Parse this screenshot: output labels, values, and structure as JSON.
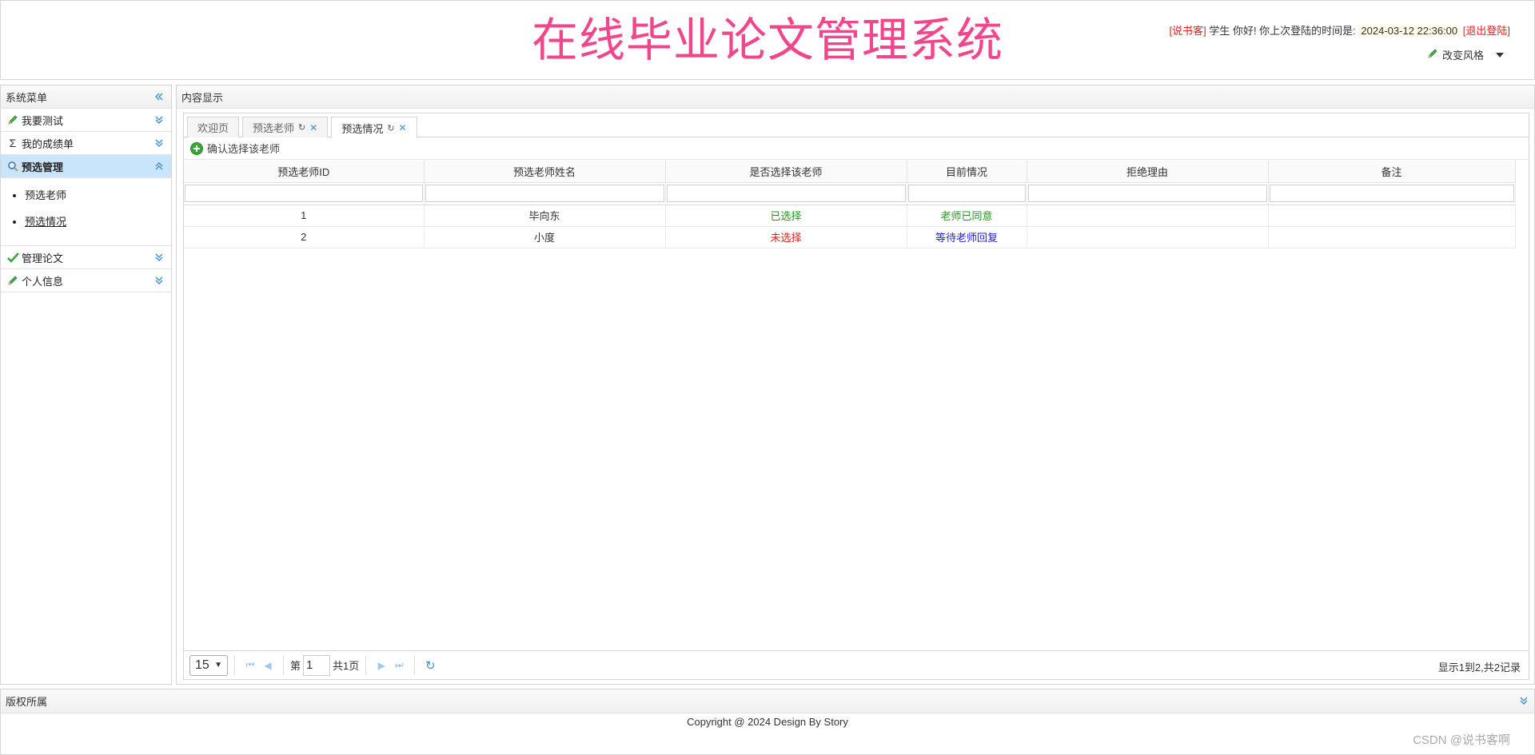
{
  "header": {
    "title": "在线毕业论文管理系统",
    "user_tag": "[说书客]",
    "greeting": "学生 你好! 你上次登陆的时间是:",
    "last_login": "2024-03-12 22:36:00",
    "logout": "[退出登陆]",
    "style_switch": "改变风格"
  },
  "sidebar": {
    "title": "系统菜单",
    "items": [
      {
        "label": "我要测试",
        "icon": "pencil-icon"
      },
      {
        "label": "我的成绩单",
        "icon": "sigma-icon"
      },
      {
        "label": "预选管理",
        "icon": "search-icon",
        "active": true
      },
      {
        "label": "管理论文",
        "icon": "check-icon"
      },
      {
        "label": "个人信息",
        "icon": "pencil-icon"
      }
    ],
    "sub_items": [
      "预选老师",
      "预选情况"
    ]
  },
  "center": {
    "title": "内容显示",
    "tabs": [
      {
        "label": "欢迎页"
      },
      {
        "label": "预选老师"
      },
      {
        "label": "预选情况"
      }
    ],
    "toolbar": {
      "confirm_label": "确认选择该老师"
    },
    "grid": {
      "columns": [
        "预选老师ID",
        "预选老师姓名",
        "是否选择该老师",
        "目前情况",
        "拒绝理由",
        "备注"
      ],
      "rows": [
        {
          "id": "1",
          "name": "毕向东",
          "selected": "已选择",
          "status": "老师已同意",
          "reason": "",
          "note": ""
        },
        {
          "id": "2",
          "name": "小度",
          "selected": "未选择",
          "status": "等待老师回复",
          "reason": "",
          "note": ""
        }
      ]
    },
    "pager": {
      "page_size": "15",
      "page_prefix": "第",
      "page_value": "1",
      "page_suffix": "共1页",
      "info": "显示1到2,共2记录"
    }
  },
  "footer": {
    "title": "版权所属",
    "copyright": "Copyright @ 2024 Design By Story",
    "watermark": "CSDN @说书客啊"
  },
  "colors": {
    "title": "#f0468c",
    "active_menu": "#c9e5fb",
    "selected_text": "#1a9b1a",
    "unselected_text": "#e02020",
    "waiting_text": "#2222dd"
  }
}
